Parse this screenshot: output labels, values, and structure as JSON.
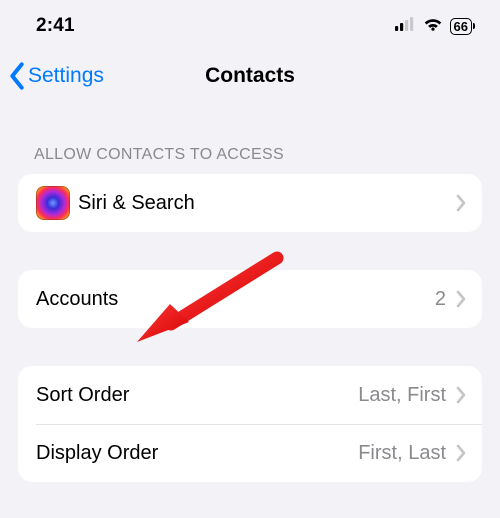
{
  "status": {
    "time": "2:41",
    "battery": "66"
  },
  "nav": {
    "back_label": "Settings",
    "title": "Contacts"
  },
  "sections": {
    "allow_header": "ALLOW CONTACTS TO ACCESS"
  },
  "rows": {
    "siri_search": {
      "label": "Siri & Search"
    },
    "accounts": {
      "label": "Accounts",
      "value": "2"
    },
    "sort_order": {
      "label": "Sort Order",
      "value": "Last, First"
    },
    "display_order": {
      "label": "Display Order",
      "value": "First, Last"
    }
  },
  "colors": {
    "accent": "#007aff",
    "annotation": "#ff0000"
  }
}
